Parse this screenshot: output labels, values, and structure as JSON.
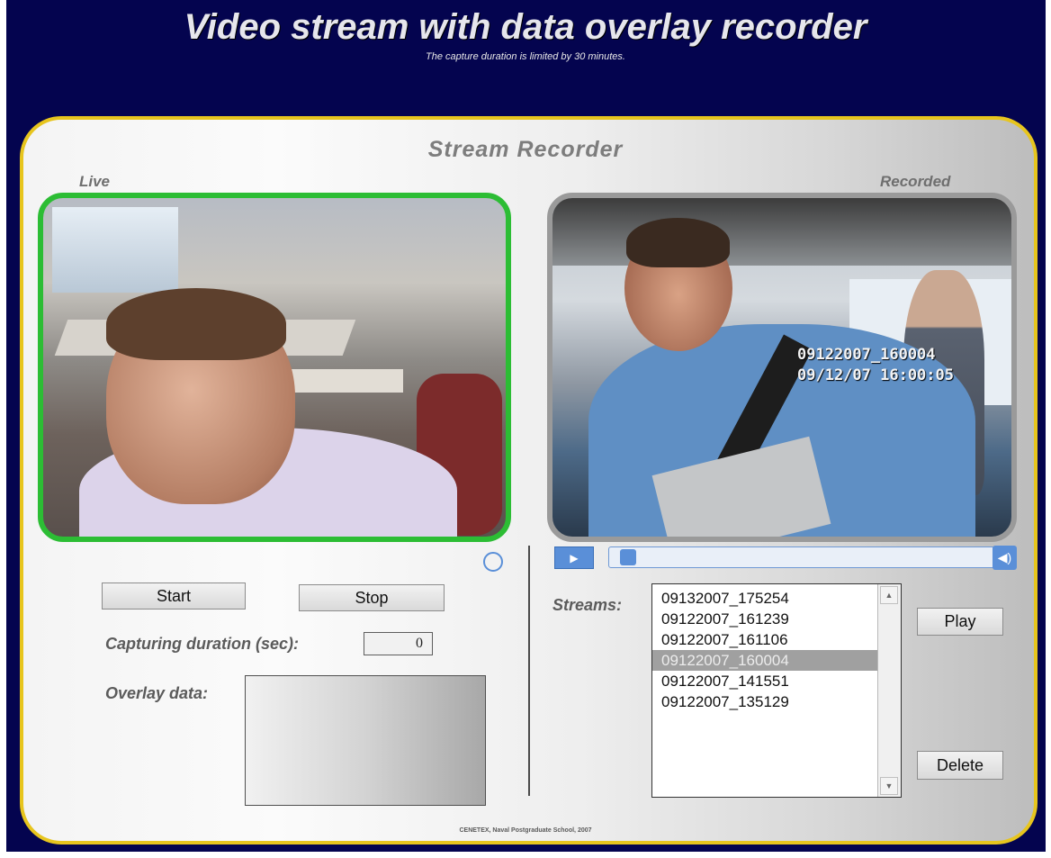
{
  "header": {
    "title": "Video stream with data overlay recorder",
    "subtitle": "The capture duration is limited by 30 minutes."
  },
  "panel": {
    "title": "Stream Recorder",
    "live_label": "Live",
    "recorded_label": "Recorded"
  },
  "recorded_overlay": {
    "line1": "09122007_160004",
    "line2": "09/12/07 16:00:05"
  },
  "controls": {
    "start_label": "Start",
    "stop_label": "Stop",
    "capturing_duration_label": "Capturing duration (sec):",
    "capturing_duration_value": "0",
    "overlay_data_label": "Overlay data:"
  },
  "player": {
    "play_icon": "play-icon",
    "seek_position": 0.02,
    "volume_icon": "speaker-icon"
  },
  "streams": {
    "label": "Streams:",
    "items": [
      {
        "name": "09132007_175254"
      },
      {
        "name": "09122007_161239"
      },
      {
        "name": "09122007_161106"
      },
      {
        "name": "09122007_160004"
      },
      {
        "name": "09122007_141551"
      },
      {
        "name": "09122007_135129"
      }
    ],
    "selected_index": 3,
    "play_label": "Play",
    "delete_label": "Delete"
  },
  "footer": {
    "text": "CENETEX, Naval Postgraduate School, 2007"
  },
  "colors": {
    "background": "#04044f",
    "panel_border": "#e7c51e",
    "live_border": "#2cbd34",
    "recorded_border": "#9a9a9a",
    "accent_blue": "#5a8fd8"
  }
}
